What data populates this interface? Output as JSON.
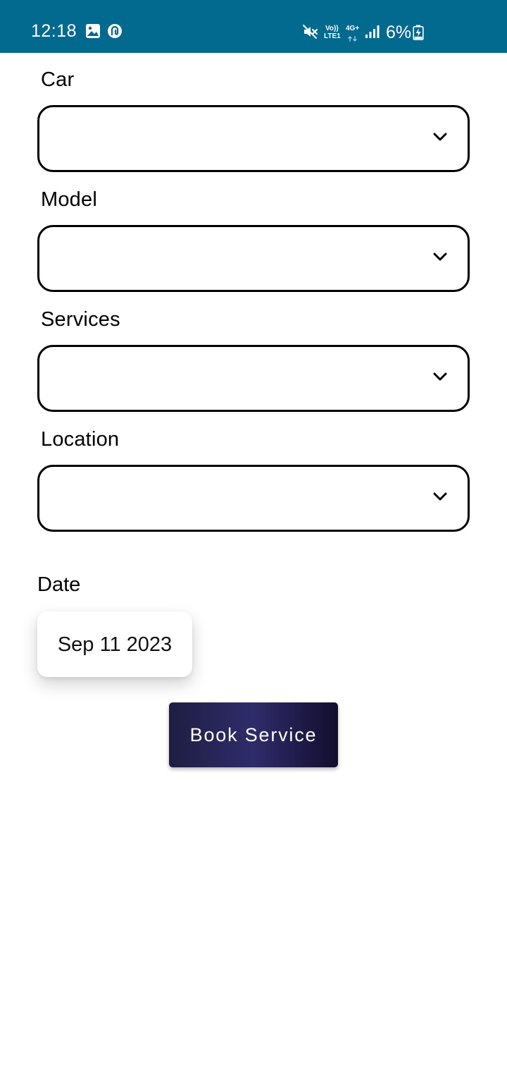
{
  "status_bar": {
    "time": "12:18",
    "volte_top": "Vo))",
    "volte_bottom": "LTE1",
    "network": "4G+",
    "battery": "6%",
    "icons": [
      "gallery-icon",
      "app-notification-icon",
      "mute-icon",
      "signal-icon",
      "battery-charging-icon"
    ],
    "background_color": "#02698f"
  },
  "form": {
    "car": {
      "label": "Car",
      "value": ""
    },
    "model": {
      "label": "Model",
      "value": ""
    },
    "services": {
      "label": "Services",
      "value": ""
    },
    "location": {
      "label": "Location",
      "value": ""
    },
    "date": {
      "label": "Date",
      "value": "Sep 11 2023"
    }
  },
  "actions": {
    "book_label": "Book Service",
    "button_colors": [
      "#1e1e42",
      "#2f2c6a",
      "#120e2e"
    ]
  }
}
